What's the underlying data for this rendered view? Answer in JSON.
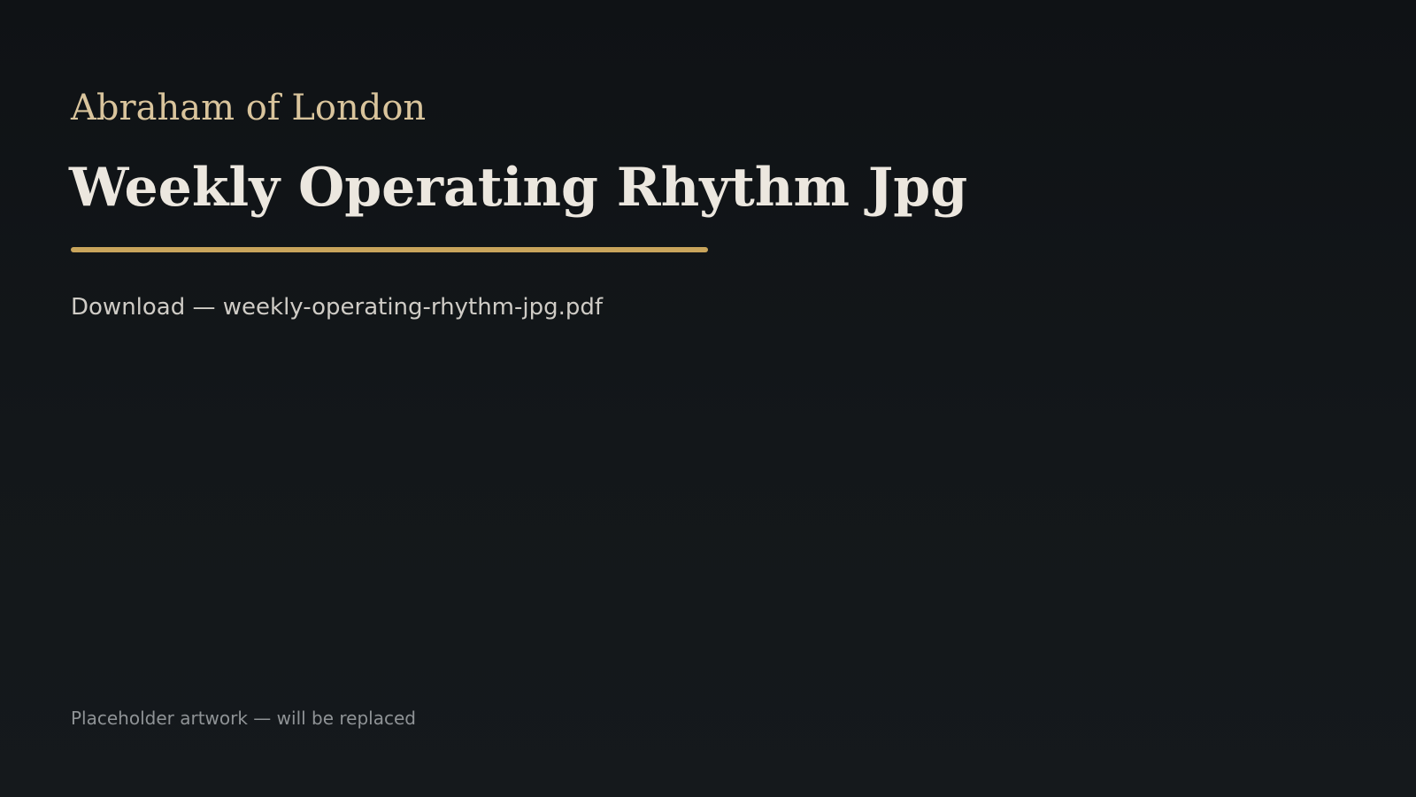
{
  "brand": {
    "name": "Abraham of London"
  },
  "main": {
    "title": "Weekly Operating Rhythm Jpg",
    "download_label": "Download — weekly-operating-rhythm-jpg.pdf"
  },
  "footer": {
    "note": "Placeholder artwork — will be replaced"
  },
  "colors": {
    "background": "#111417",
    "brand": "#d9c49c",
    "title": "#ece7df",
    "accent_rule": "#c9a55c",
    "download_text": "#cfccc6",
    "note_text": "#8f9396"
  }
}
